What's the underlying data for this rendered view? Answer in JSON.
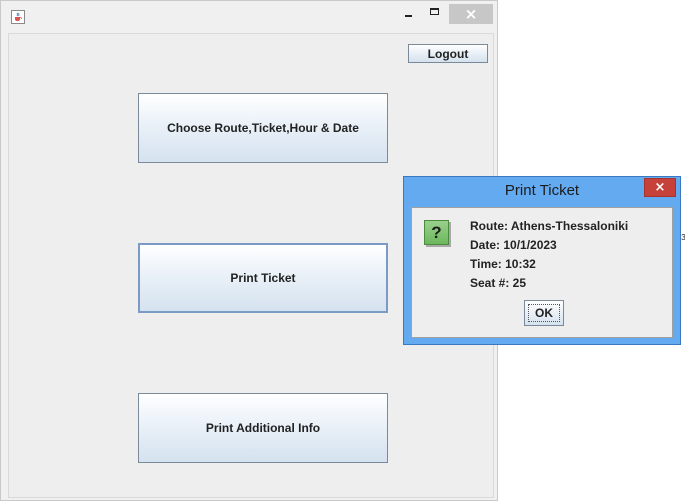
{
  "main_window": {
    "buttons": {
      "logout": "Logout",
      "choose_route": "Choose Route,Ticket,Hour & Date",
      "print_ticket": "Print Ticket",
      "print_additional_info": "Print Additional Info"
    }
  },
  "dialog": {
    "title": "Print Ticket",
    "lines": [
      "Route: Athens-Thessaloniki",
      "Date: 10/1/2023",
      "Time: 10:32",
      "Seat #: 25"
    ],
    "ok_label": "OK",
    "icon_glyph": "?"
  },
  "icons": {
    "app_icon": "java-cup-icon",
    "dialog_icon": "question-icon"
  },
  "colors": {
    "dialog_frame": "#63aaf0",
    "close_button": "#c6413a",
    "question_icon": "#6bb85c"
  }
}
